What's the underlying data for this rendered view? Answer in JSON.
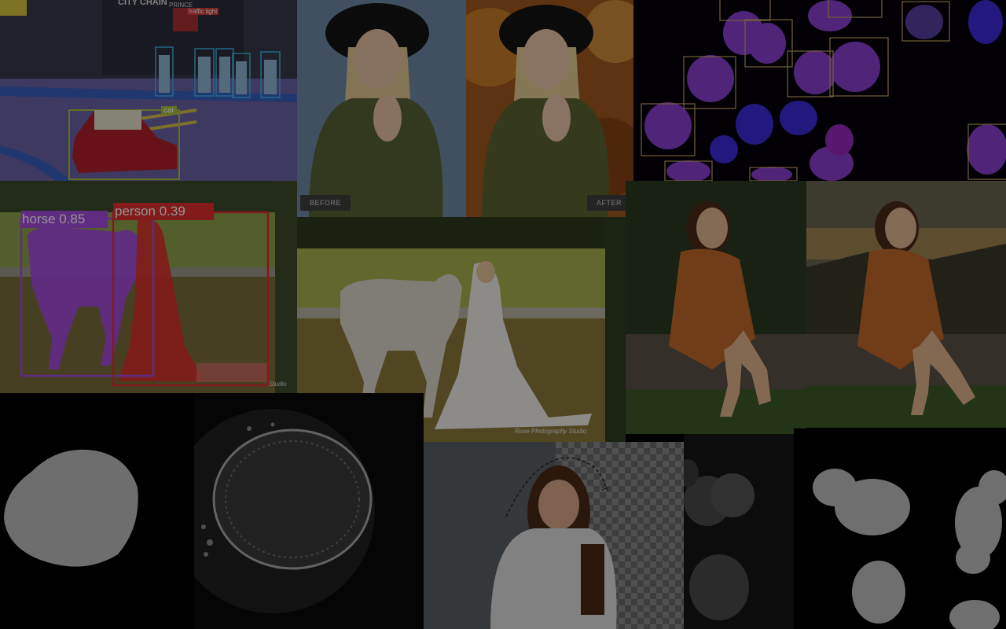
{
  "tiles": {
    "street": {
      "car_label": "car",
      "traffic_label": "traffic light",
      "sign_text": "CITY CHAIN",
      "sign_text2": "PRINCE"
    },
    "before_after": {
      "before_label": "BEFORE",
      "after_label": "AFTER"
    },
    "segmentation": {
      "horse_label": "horse 0.85",
      "person_label": "person 0.39",
      "watermark": "Studio"
    },
    "wedding": {
      "watermark": "Rose Photography Studio"
    }
  },
  "colors": {
    "horse_box": "#a64ce0",
    "person_box": "#e0302c",
    "cell_box": "#c9a66b",
    "car_box": "#a5c23a",
    "person_det_box": "#3fb4e6",
    "dim_overlay": "rgba(0,0,0,0.42)"
  },
  "icons": [
    "scissors-icon",
    "checkerboard-pattern"
  ]
}
